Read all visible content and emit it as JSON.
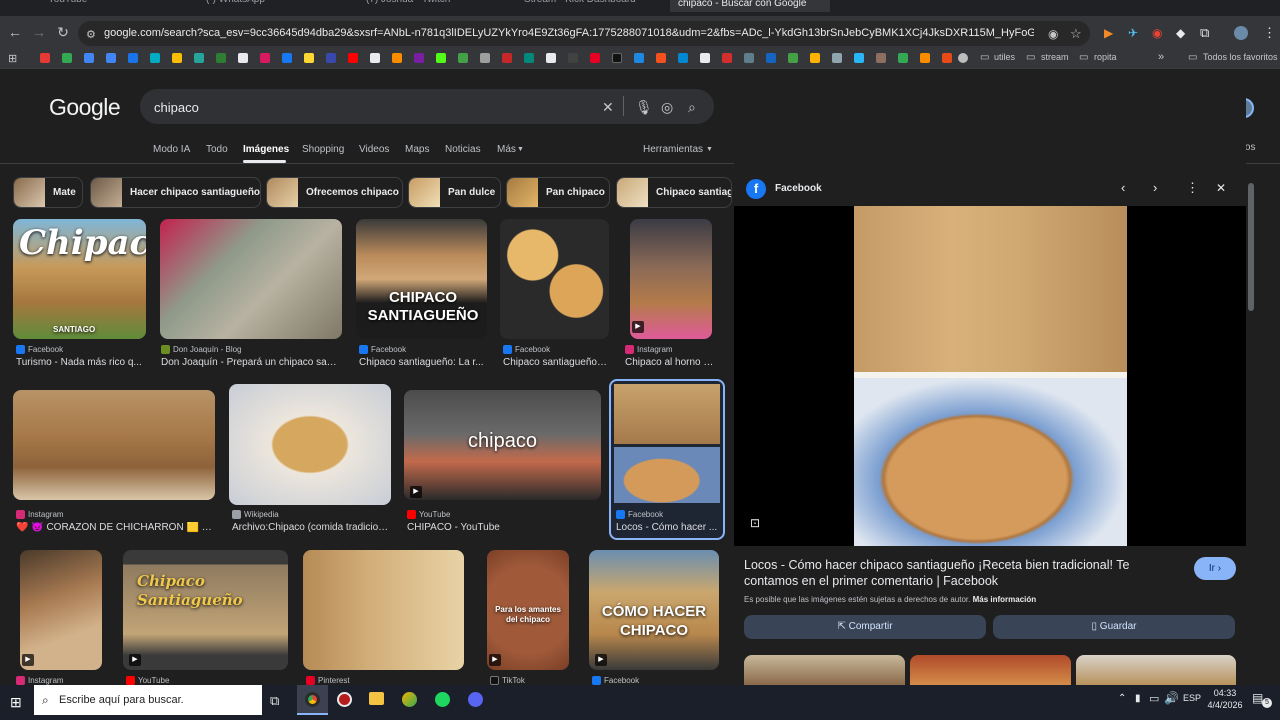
{
  "browser": {
    "tabs": [
      "YouTube",
      "(·) WhatsApp",
      "(7) Joshua - Twitch",
      "Stream - Kick Dashboard",
      "chipaco - Buscar con Google"
    ],
    "url": "google.com/search?sca_esv=9cc36645d94dba29&sxsrf=ANbL-n781q3lIDELyUZYkYro4E9Zt36gFA:1775288071018&udm=2&fbs=ADc_l-YkdGh13brSnJebCyBMK1XCj4JksDXR115M_HyFoGEzmGafvo8eZEBC08B3PCASSVSNy889rr...",
    "bookmark_folders": [
      "utiles",
      "stream",
      "ropita"
    ],
    "all_bookmarks": "Todos los favoritos"
  },
  "google": {
    "logo": "Google",
    "query": "chipaco",
    "nav_tabs": [
      "Modo IA",
      "Todo",
      "Imágenes",
      "Shopping",
      "Videos",
      "Maps",
      "Noticias",
      "Más"
    ],
    "active_tab": "Imágenes",
    "tools": "Herramientas",
    "saved": "Guardados",
    "chips": [
      "Mate",
      "Hacer chipaco santiagueño",
      "Ofrecemos chipaco",
      "Pan dulce",
      "Pan chipaco",
      "Chipaco santiagueño"
    ]
  },
  "results": [
    {
      "source": "Facebook",
      "title": "Turismo - Nada más rico q...",
      "overlay": "Chipaco",
      "brand": "SANTIAGO"
    },
    {
      "source": "Don Joaquín - Blog",
      "title": "Don Joaquín - Prepará un chipaco sant..."
    },
    {
      "source": "Facebook",
      "title": "Chipaco santiagueño: La r...",
      "overlay": "CHIPACO SANTIAGUEÑO"
    },
    {
      "source": "Facebook",
      "title": "Chipaco santiagueño:..."
    },
    {
      "source": "Instagram",
      "title": "Chipaco al horno d..."
    },
    {
      "source": "Instagram",
      "title": "❤️ 😈 CORAZÓN DE CHICHARRÓN 🟨 El ..."
    },
    {
      "source": "Wikipedia",
      "title": "Archivo:Chipaco (comida tradicion..."
    },
    {
      "source": "YouTube",
      "title": "CHIPACO - YouTube",
      "overlay": "chipaco"
    },
    {
      "source": "Facebook",
      "title": "Locos - Cómo hacer ..."
    },
    {
      "source": "Instagram",
      "title": ""
    },
    {
      "source": "YouTube",
      "title": "",
      "overlay": "Chipaco Santiagueño"
    },
    {
      "source": "Pinterest",
      "title": ""
    },
    {
      "source": "TikTok",
      "title": "",
      "overlay": "Para los amantes del chipaco"
    },
    {
      "source": "Facebook",
      "title": "",
      "overlay": "CÓMO HACER CHIPACO"
    }
  ],
  "panel": {
    "source": "Facebook",
    "title": "Locos - Cómo hacer chipaco santiagueño ¡Receta bien tradicional! Te contamos en el primer comentario | Facebook",
    "visit": "Ir",
    "copyright": "Es posible que las imágenes estén sujetas a derechos de autor.",
    "more_info": "Más información",
    "share": "Compartir",
    "save": "Guardar"
  },
  "taskbar": {
    "search_placeholder": "Escribe aquí para buscar.",
    "lang": "ESP",
    "time": "04:33",
    "date": "4/4/2026",
    "notif": "5"
  }
}
